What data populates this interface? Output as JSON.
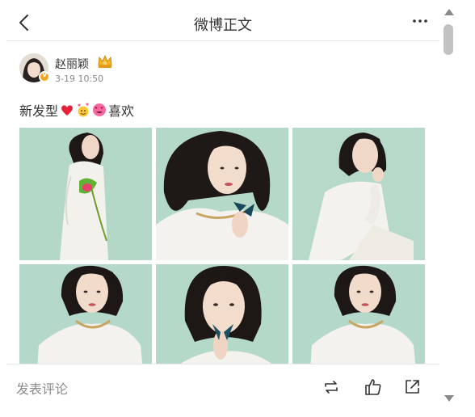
{
  "header": {
    "title": "微博正文"
  },
  "author": {
    "name": "赵丽颖",
    "time": "3-19 10:50",
    "verified_badge": "v"
  },
  "post": {
    "text_start": "新发型",
    "text_end": "喜欢",
    "emojis": [
      "heart-emoji",
      "hearts-face-emoji",
      "heart-eyes-emoji"
    ]
  },
  "photos": [
    {
      "name": "photo-1",
      "pose": "full-body-with-flower"
    },
    {
      "name": "photo-2",
      "pose": "hand-on-chin-butterfly-ring"
    },
    {
      "name": "photo-3",
      "pose": "seated-hand-on-cheek"
    },
    {
      "name": "photo-4",
      "pose": "portrait-front"
    },
    {
      "name": "photo-5",
      "pose": "butterfly-ring-at-mouth"
    },
    {
      "name": "photo-6",
      "pose": "portrait-front"
    }
  ],
  "bottom_bar": {
    "comment_label": "发表评论"
  },
  "colors": {
    "photo_bg": "#b2d6c7",
    "text": "#333333",
    "muted": "#8a8a8a",
    "badge": "#f5a623",
    "heart": "#e8213a"
  }
}
